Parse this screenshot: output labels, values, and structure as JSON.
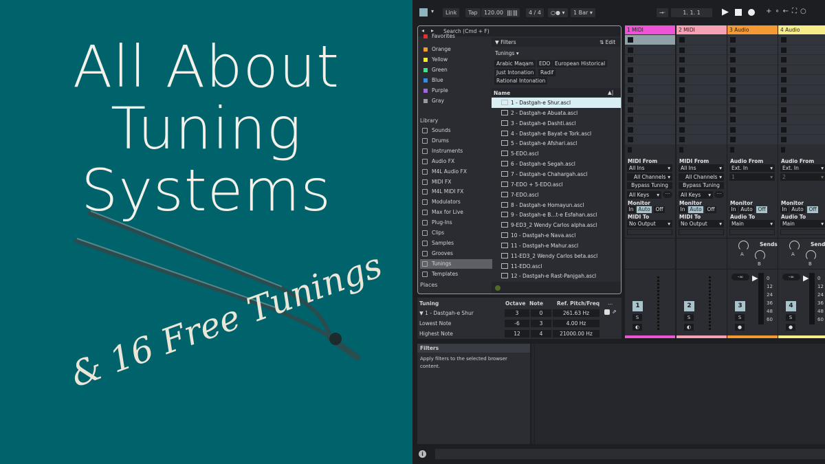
{
  "promo": {
    "title_lines": [
      "All About",
      "Tuning",
      "Systems"
    ],
    "subtitle": "& 16 Free Tunings",
    "background": "#00636b"
  },
  "transport": {
    "link": "Link",
    "tap": "Tap",
    "tempo": "120.00",
    "signature": "4 / 4",
    "quantize": "1 Bar",
    "position": "1.  1.  1"
  },
  "browser": {
    "search_placeholder": "Search (Cmd + F)",
    "collections": [
      {
        "label": "Favorites",
        "color": "#e0312b"
      },
      {
        "label": "Orange",
        "color": "#f39a2e"
      },
      {
        "label": "Yellow",
        "color": "#f2e93a"
      },
      {
        "label": "Green",
        "color": "#3de58a"
      },
      {
        "label": "Blue",
        "color": "#2b8ff0"
      },
      {
        "label": "Purple",
        "color": "#a665e8"
      },
      {
        "label": "Gray",
        "color": "#9a9a9a"
      }
    ],
    "library_heading": "Library",
    "library": [
      {
        "label": "Sounds",
        "icon": "note-icon"
      },
      {
        "label": "Drums",
        "icon": "grid-icon"
      },
      {
        "label": "Instruments",
        "icon": "power-icon"
      },
      {
        "label": "Audio FX",
        "icon": "device-icon"
      },
      {
        "label": "M4L Audio FX",
        "icon": "device-icon"
      },
      {
        "label": "MIDI FX",
        "icon": "device-icon"
      },
      {
        "label": "M4L MIDI FX",
        "icon": "device-icon"
      },
      {
        "label": "Modulators",
        "icon": "wave-icon"
      },
      {
        "label": "Max for Live",
        "icon": "loop-icon"
      },
      {
        "label": "Plug-Ins",
        "icon": "plug-icon"
      },
      {
        "label": "Clips",
        "icon": "clip-icon"
      },
      {
        "label": "Samples",
        "icon": "sample-icon"
      },
      {
        "label": "Grooves",
        "icon": "groove-icon"
      },
      {
        "label": "Tunings",
        "icon": "tuning-icon",
        "selected": true
      },
      {
        "label": "Templates",
        "icon": "template-icon"
      }
    ],
    "places_heading": "Places",
    "filters_label": "Filters",
    "edit_label": "Edit",
    "tunings_dropdown": "Tunings",
    "tags": [
      "Arabic Maqam",
      "EDO",
      "European Historical",
      "Just Intonation",
      "Radif",
      "Rational Intonation"
    ],
    "column_name": "Name",
    "files": [
      "1 - Dastgah-e Shur.ascl",
      "2 - Dastgah-e Abuata.ascl",
      "3 - Dastgah-e Dashti.ascl",
      "4 - Dastgah-e Bayat-e Tork.ascl",
      "5 - Dastgah-e Afshari.ascl",
      "5-EDO.ascl",
      "6 - Dastgah-e Segah.ascl",
      "7 - Dastgah-e Chahargah.ascl",
      "7-EDO + 5-EDO.ascl",
      "7-EDO.ascl",
      "8 - Dastgah-e Homayun.ascl",
      "9 - Dastgah-e B...t-e Esfahan.ascl",
      "9-ED3_2 Wendy Carlos alpha.ascl",
      "10 - Dastgah-e Nava.ascl",
      "11 - Dastgah-e Mahur.ascl",
      "11-ED3_2 Wendy Carlos beta.ascl",
      "11-EDO.ascl",
      "12 - Dastgah-e Rast-Panjgah.ascl"
    ]
  },
  "tuning_panel": {
    "headers": [
      "Tuning",
      "Octave",
      "Note",
      "Ref. Pitch/Freq",
      "..."
    ],
    "rows": [
      {
        "label": "1 - Dastgah-e Shur",
        "octave": "3",
        "note": "0",
        "freq": "261.63 Hz"
      },
      {
        "label": "Lowest Note",
        "octave": "-6",
        "note": "3",
        "freq": "4.00 Hz"
      },
      {
        "label": "Highest Note",
        "octave": "12",
        "note": "4",
        "freq": "21000.00 Hz"
      }
    ]
  },
  "info": {
    "title": "Filters",
    "text": "Apply filters to the selected browser content."
  },
  "tracks": [
    {
      "name": "1 MIDI",
      "color": "#f054d6",
      "num": "1",
      "from_label": "MIDI From",
      "from": "All Ins",
      "channel": "All Channels",
      "bypass": "Bypass Tuning",
      "keys": "All Keys",
      "monitor": "Monitor",
      "mon": [
        "In",
        "Auto",
        "Off"
      ],
      "to_label": "MIDI To",
      "to": "No Output"
    },
    {
      "name": "2 MIDI",
      "color": "#f7a1b4",
      "num": "2",
      "from_label": "MIDI From",
      "from": "All Ins",
      "channel": "All Channels",
      "bypass": "Bypass Tuning",
      "keys": "All Keys",
      "monitor": "Monitor",
      "mon": [
        "In",
        "Auto",
        "Off"
      ],
      "to_label": "MIDI To",
      "to": "No Output"
    },
    {
      "name": "3 Audio",
      "color": "#f59a32",
      "num": "3",
      "from_label": "Audio From",
      "from": "Ext. In",
      "channel": "1",
      "monitor": "Monitor",
      "mon": [
        "In",
        "Auto",
        "Off"
      ],
      "to_label": "Audio To",
      "to": "Main",
      "sends": "Sends",
      "volume": "-∞"
    },
    {
      "name": "4 Audio",
      "color": "#f7ec8a",
      "num": "4",
      "from_label": "Audio From",
      "from": "Ext. In",
      "channel": "2",
      "monitor": "Monitor",
      "mon": [
        "In",
        "Auto",
        "Off"
      ],
      "to_label": "Audio To",
      "to": "Main",
      "sends": "Sends",
      "volume": "-∞"
    }
  ],
  "send_labels": [
    "A",
    "B"
  ],
  "solo": "S",
  "meter_scale": [
    "0",
    "12",
    "24",
    "36",
    "48",
    "60"
  ]
}
